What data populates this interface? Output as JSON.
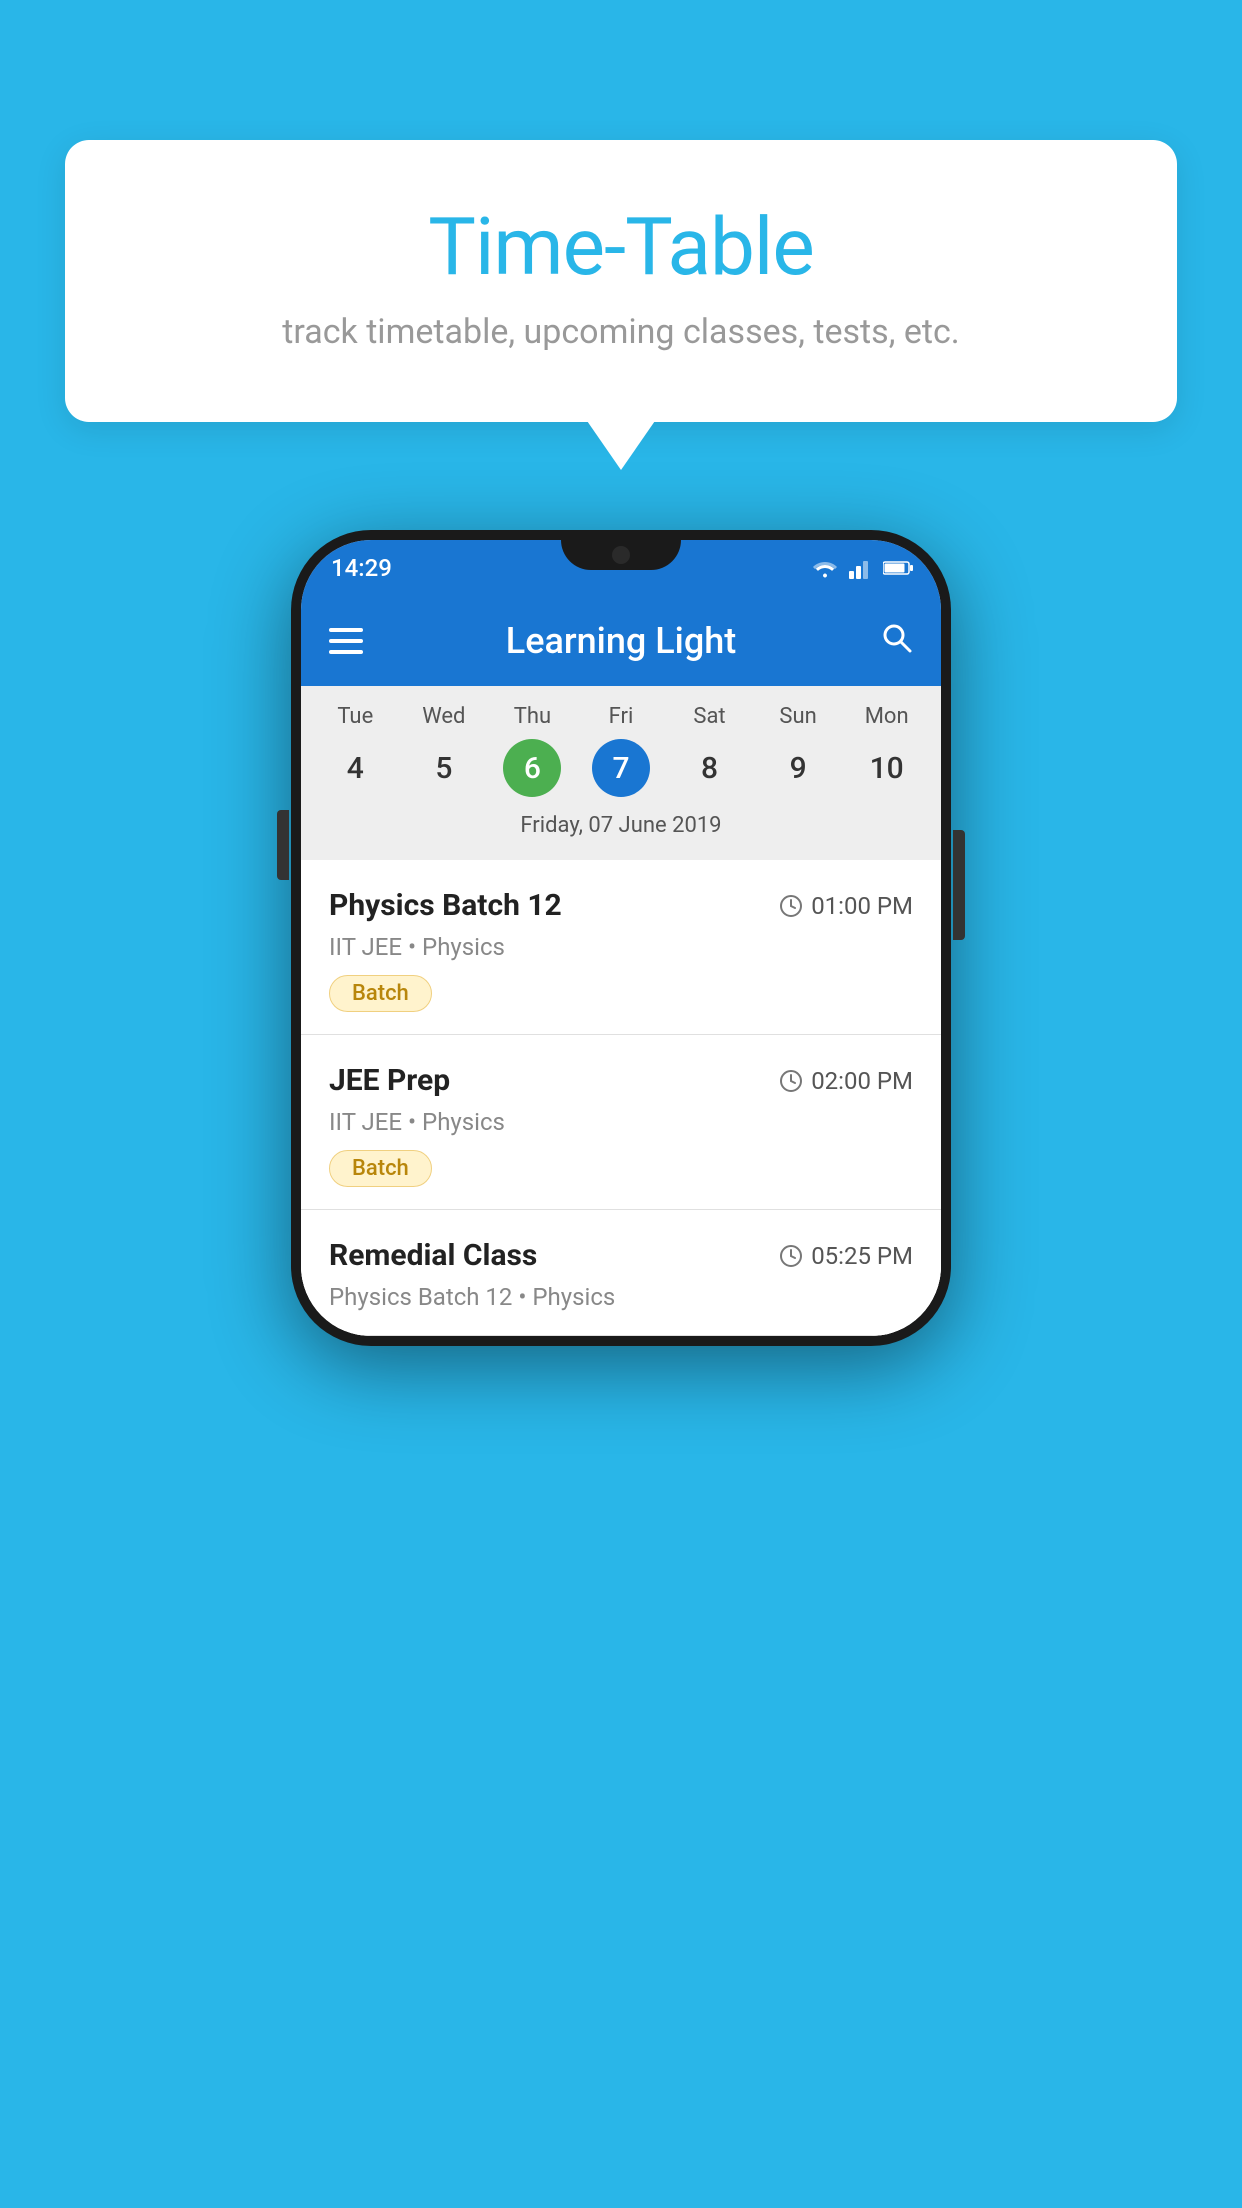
{
  "background_color": "#29b6e8",
  "tooltip": {
    "title": "Time-Table",
    "subtitle": "track timetable, upcoming classes, tests, etc."
  },
  "phone": {
    "status_bar": {
      "time": "14:29"
    },
    "app_bar": {
      "title": "Learning Light"
    },
    "calendar": {
      "days": [
        {
          "name": "Tue",
          "num": "4",
          "state": "normal"
        },
        {
          "name": "Wed",
          "num": "5",
          "state": "normal"
        },
        {
          "name": "Thu",
          "num": "6",
          "state": "today"
        },
        {
          "name": "Fri",
          "num": "7",
          "state": "selected"
        },
        {
          "name": "Sat",
          "num": "8",
          "state": "normal"
        },
        {
          "name": "Sun",
          "num": "9",
          "state": "normal"
        },
        {
          "name": "Mon",
          "num": "10",
          "state": "normal"
        }
      ],
      "selected_date_label": "Friday, 07 June 2019"
    },
    "schedule": [
      {
        "title": "Physics Batch 12",
        "time": "01:00 PM",
        "subtitle": "IIT JEE • Physics",
        "badge": "Batch"
      },
      {
        "title": "JEE Prep",
        "time": "02:00 PM",
        "subtitle": "IIT JEE • Physics",
        "badge": "Batch"
      },
      {
        "title": "Remedial Class",
        "time": "05:25 PM",
        "subtitle": "Physics Batch 12 • Physics",
        "badge": null
      }
    ]
  }
}
